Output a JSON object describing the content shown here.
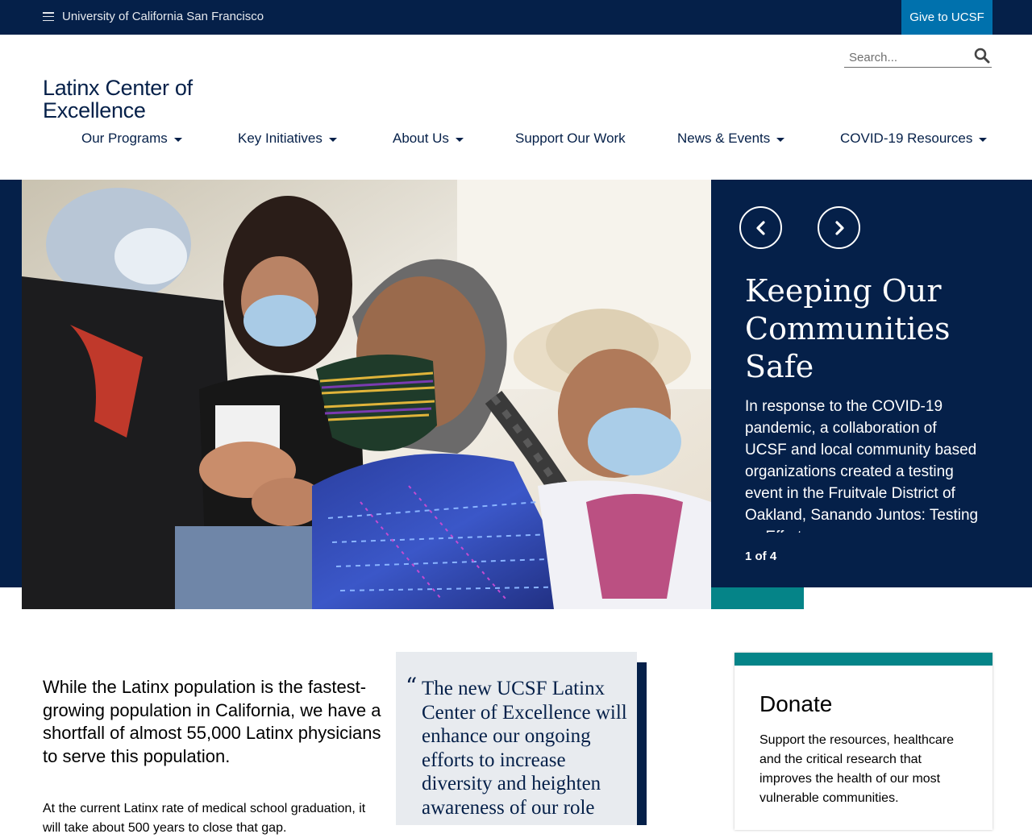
{
  "topbar": {
    "university": "University of California San Francisco",
    "give_label": "Give to UCSF"
  },
  "colors": {
    "navy": "#052049",
    "blue": "#0071ad",
    "teal": "#058488",
    "quote_bg": "#e8ebef"
  },
  "search": {
    "placeholder": "Search..."
  },
  "site": {
    "title": "Latinx Center of Excellence"
  },
  "nav": {
    "items": [
      {
        "label": "Our Programs",
        "dropdown": true
      },
      {
        "label": "Key Initiatives",
        "dropdown": true
      },
      {
        "label": "About Us",
        "dropdown": true
      },
      {
        "label": "Support Our Work",
        "dropdown": false
      },
      {
        "label": "News & Events",
        "dropdown": true
      },
      {
        "label": "COVID-19 Resources",
        "dropdown": true
      }
    ]
  },
  "slider": {
    "title": "Keeping Our Communities Safe",
    "text": "In response to the COVID-19 pandemic, a collaboration of UCSF and local community based organizations created a testing event in the Fruitvale District of Oakland, Sanando Juntos: Testing as Effort",
    "counter": "1 of 4",
    "prev_icon": "chevron-left-icon",
    "next_icon": "chevron-right-icon"
  },
  "intro": {
    "lead": "While the Latinx population is the fastest-growing population in California, we have a shortfall of almost 55,000 Latinx physicians to serve this population.",
    "body": "At the current Latinx rate of medical school graduation, it will take about 500 years to close that gap."
  },
  "quote": {
    "mark": "“",
    "text": "The new UCSF Latinx Center of Excellence will enhance our ongoing efforts to increase diversity and heighten awareness of our role"
  },
  "donate": {
    "title": "Donate",
    "text": "Support the resources, healthcare and the critical research that improves the health of our most vulnerable communities."
  }
}
